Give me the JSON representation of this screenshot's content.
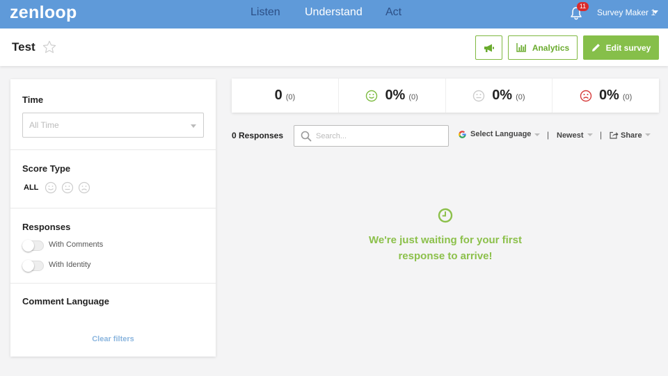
{
  "app": {
    "logo": "zenloop"
  },
  "nav": {
    "listen": "Listen",
    "understand": "Understand",
    "act": "Act"
  },
  "notifications": {
    "count": "11"
  },
  "user": {
    "name": "Survey Maker 1"
  },
  "survey": {
    "title": "Test"
  },
  "buttons": {
    "analytics": "Analytics",
    "edit": "Edit survey"
  },
  "filters": {
    "time": {
      "title": "Time",
      "placeholder": "All Time"
    },
    "score_type": {
      "title": "Score Type",
      "all": "ALL"
    },
    "responses": {
      "title": "Responses",
      "with_comments": "With Comments",
      "with_identity": "With Identity"
    },
    "comment_language": {
      "title": "Comment Language"
    },
    "clear": "Clear filters"
  },
  "stats": [
    {
      "value": "0",
      "count": "(0)",
      "icon": "none"
    },
    {
      "value": "0%",
      "count": "(0)",
      "icon": "promoter-smile-icon",
      "color": "#7cbb3f"
    },
    {
      "value": "0%",
      "count": "(0)",
      "icon": "passive-neutral-icon",
      "color": "#cccccc"
    },
    {
      "value": "0%",
      "count": "(0)",
      "icon": "detractor-frown-icon",
      "color": "#d63a3a"
    }
  ],
  "toolbar": {
    "responses": "0 Responses",
    "search_placeholder": "Search...",
    "language": "Select Language",
    "sort": "Newest",
    "share": "Share"
  },
  "empty_state": {
    "line1": "We're just waiting for your first",
    "line2": "response to arrive!"
  },
  "colors": {
    "topbar": "#5f9ad9",
    "accent_green": "#86bf4a",
    "red": "#d63a3a"
  }
}
